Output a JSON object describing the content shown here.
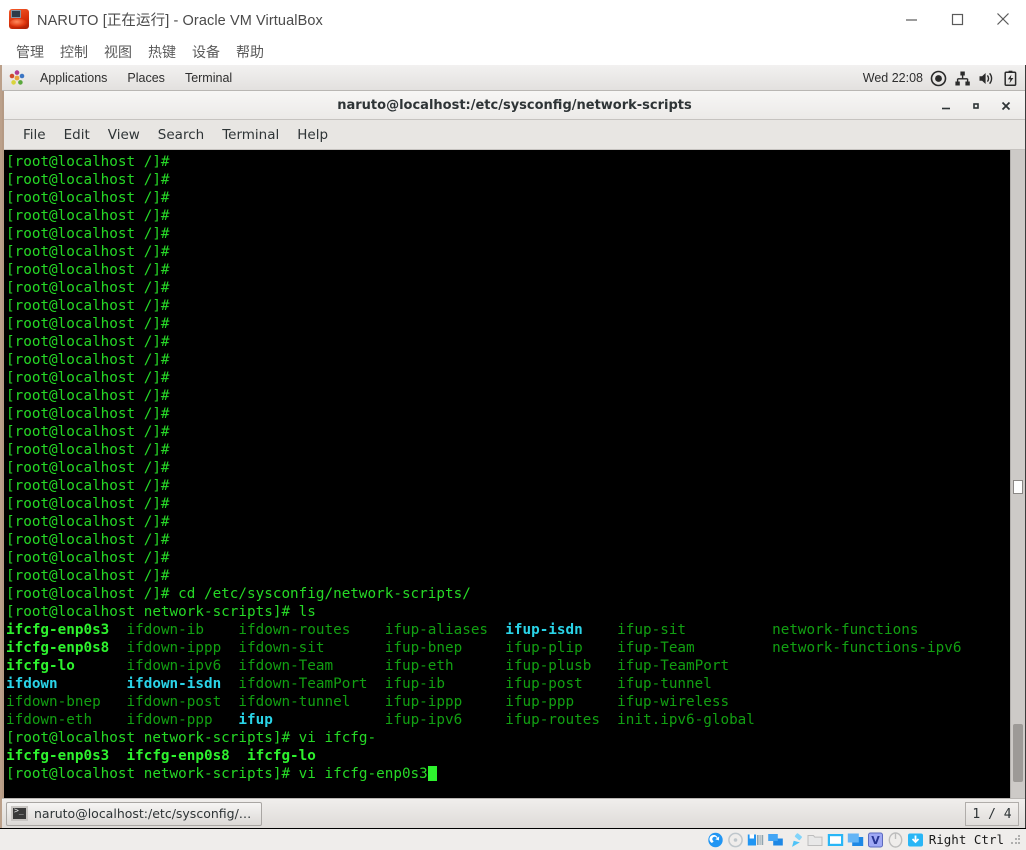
{
  "vbox": {
    "title": "NARUTO [正在运行] - Oracle VM VirtualBox",
    "app_icon": "virtualbox-icon",
    "menu": [
      "管理",
      "控制",
      "视图",
      "热键",
      "设备",
      "帮助"
    ],
    "window_controls": {
      "minimize": "minimize-icon",
      "maximize": "maximize-icon",
      "close": "close-icon"
    },
    "statusbar": {
      "host_key": "Right Ctrl",
      "icons": [
        "hard-disk-icon",
        "optical-disk-icon",
        "floppy-disk-icon",
        "network-icon",
        "usb-icon",
        "shared-folders-icon",
        "display-icon",
        "video-capture-icon",
        "virtualization-icon",
        "mouse-icon",
        "keyboard-icon"
      ]
    }
  },
  "gnome_panel": {
    "icon": "gnome-foot-icon",
    "menus": [
      "Applications",
      "Places",
      "Terminal"
    ],
    "clock": "Wed 22:08",
    "tray": [
      "power-icon",
      "network-icon",
      "volume-icon",
      "battery-icon"
    ]
  },
  "terminal_window": {
    "title": "naruto@localhost:/etc/sysconfig/network-scripts",
    "menu": [
      "File",
      "Edit",
      "View",
      "Search",
      "Terminal",
      "Help"
    ],
    "controls": {
      "minimize": "_",
      "maximize": "▫",
      "close": "✕"
    }
  },
  "taskbar": {
    "task_icon": "terminal-icon",
    "task_label": "naruto@localhost:/etc/sysconfig/net…",
    "workspace": "1 / 4"
  },
  "terminal": {
    "colors": {
      "background": "#000000",
      "prompt_green": "#26d926",
      "dim_green": "#12a012",
      "bold_green": "#2ef22e",
      "symlink_cyan": "#2ad4e8"
    },
    "prompt_root": "[root@localhost /]# ",
    "prompt_cwd": "[root@localhost network-scripts]# ",
    "blank_prompt_count": 24,
    "commands": [
      {
        "prompt": "[root@localhost /]# ",
        "command": "cd /etc/sysconfig/network-scripts/"
      },
      {
        "prompt": "[root@localhost network-scripts]# ",
        "command": "ls"
      }
    ],
    "ls_columns": [
      [
        "ifcfg-enp0s3",
        "ifcfg-enp0s8",
        "ifcfg-lo",
        "ifdown",
        "ifdown-bnep",
        "ifdown-eth"
      ],
      [
        "ifdown-ib",
        "ifdown-ippp",
        "ifdown-ipv6",
        "ifdown-isdn",
        "ifdown-post",
        "ifdown-ppp"
      ],
      [
        "ifdown-routes",
        "ifdown-sit",
        "ifdown-Team",
        "ifdown-TeamPort",
        "ifdown-tunnel",
        "ifup"
      ],
      [
        "ifup-aliases",
        "ifup-bnep",
        "ifup-eth",
        "ifup-ib",
        "ifup-ippp",
        "ifup-ipv6"
      ],
      [
        "ifup-isdn",
        "ifup-plip",
        "ifup-plusb",
        "ifup-post",
        "ifup-ppp",
        "ifup-routes"
      ],
      [
        "ifup-sit",
        "ifup-Team",
        "ifup-TeamPort",
        "ifup-tunnel",
        "ifup-wireless",
        "init.ipv6-global"
      ],
      [
        "network-functions",
        "network-functions-ipv6",
        "",
        "",
        "",
        ""
      ]
    ],
    "ls_cyan_entries": [
      "ifdown",
      "ifdown-isdn",
      "ifup",
      "ifup-isdn"
    ],
    "ls_bold_entries": [
      "ifcfg-enp0s3",
      "ifcfg-enp0s8",
      "ifcfg-lo"
    ],
    "tab_completion": {
      "prompt": "[root@localhost network-scripts]# ",
      "command": "vi ifcfg-",
      "suggestions": "ifcfg-enp0s3  ifcfg-enp0s8  ifcfg-lo"
    },
    "final_line": {
      "prompt": "[root@localhost network-scripts]# ",
      "command": "vi ifcfg-enp0s3",
      "cursor": true
    }
  }
}
